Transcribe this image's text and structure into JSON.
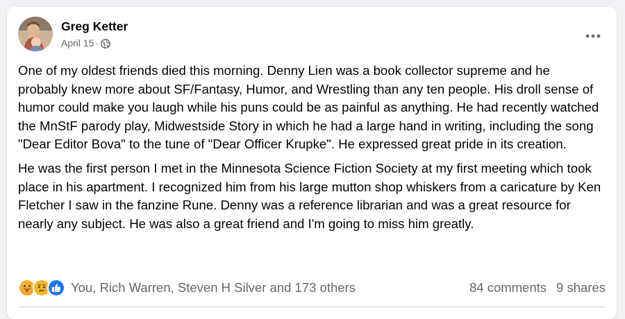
{
  "post": {
    "author": "Greg Ketter",
    "date": "April 15",
    "separator": "·",
    "paragraphs": [
      "One of my oldest friends died this morning.  Denny Lien was a book collector supreme and he probably knew more about SF/Fantasy, Humor, and Wrestling than any ten people.  His droll sense of humor  could make you laugh while his puns could be as painful as anything.  He had recently watched the MnStF parody play, Midwestside Story in which he had a large hand in writing, including the song \"Dear Editor Bova\" to the tune of \"Dear Officer Krupke\".  He expressed great pride in its creation.",
      "He was the first person I met in the Minnesota Science Fiction Society at my first meeting which took place in his apartment.  I recognized him from his large mutton shop whiskers from a caricature by Ken Fletcher I saw in the fanzine Rune.  Denny was a reference librarian and was a great resource for nearly any subject.  He was also a great friend and I'm going to miss him greatly."
    ]
  },
  "reactions": {
    "icons": [
      "care-icon",
      "sad-icon",
      "like-icon"
    ],
    "summary": "You, Rich Warren, Steven H Silver and 173 others"
  },
  "stats": {
    "comments": "84 comments",
    "shares": "9 shares"
  },
  "colors": {
    "like": "#1877f2",
    "care": "#f7b125",
    "sad": "#f7b125",
    "muted_text": "#65676b",
    "text": "#050505"
  }
}
